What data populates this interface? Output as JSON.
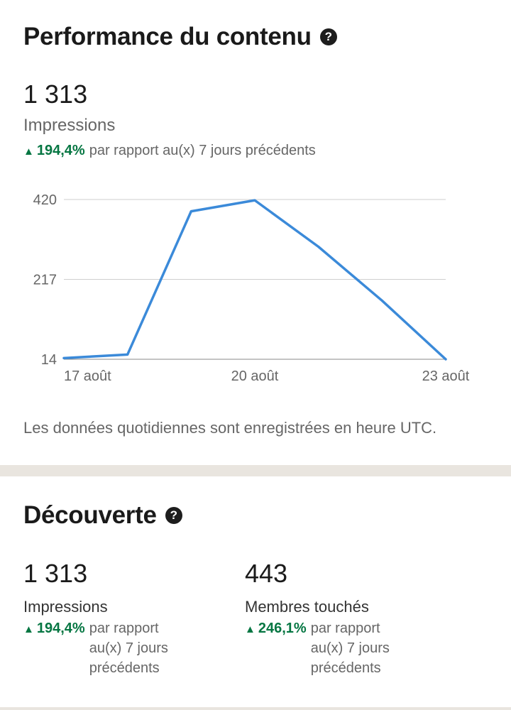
{
  "performance": {
    "title": "Performance du contenu",
    "help_icon": "question-circle-icon",
    "impressions_value": "1 313",
    "impressions_label": "Impressions",
    "change_pct": "194,4%",
    "change_text": "par rapport au(x) 7 jours précédents",
    "footnote": "Les données quotidiennes sont enregistrées en heure UTC."
  },
  "chart_data": {
    "type": "line",
    "x": [
      "17 août",
      "18 août",
      "19 août",
      "20 août",
      "21 août",
      "22 août",
      "23 août"
    ],
    "series": [
      {
        "values": [
          17,
          26,
          390,
          418,
          300,
          163,
          14
        ]
      }
    ],
    "x_tick_labels": [
      "17 août",
      "20 août",
      "23 août"
    ],
    "y_ticks": [
      "420",
      "217",
      "14"
    ],
    "ylim": [
      14,
      420
    ],
    "grid": true,
    "line_color": "#3b8ad9"
  },
  "discovery": {
    "title": "Découverte",
    "help_icon": "question-circle-icon",
    "metrics": [
      {
        "value": "1 313",
        "label": "Impressions",
        "change_pct": "194,4%",
        "change_text": "par rapport au(x) 7 jours précédents"
      },
      {
        "value": "443",
        "label": "Membres touchés",
        "change_pct": "246,1%",
        "change_text": "par rapport au(x) 7 jours précédents"
      }
    ]
  },
  "colors": {
    "positive": "#057642",
    "separator": "#e9e5df"
  }
}
